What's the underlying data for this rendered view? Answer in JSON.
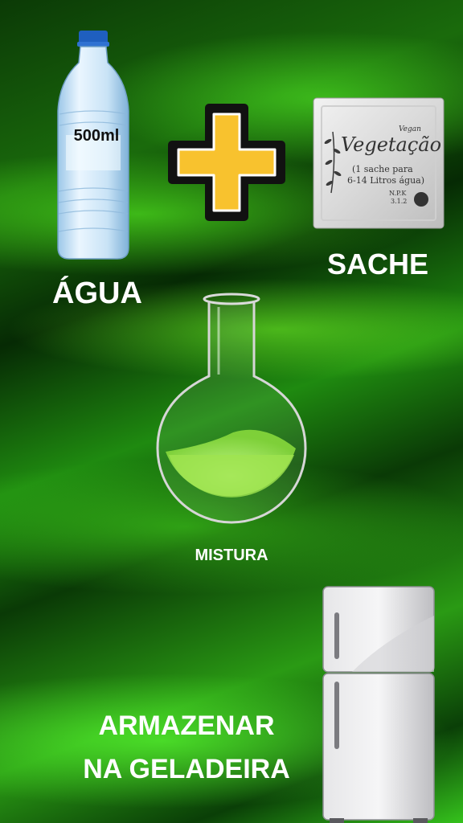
{
  "bottle": {
    "volume_label": "500ml"
  },
  "sachet": {
    "tagline": "Vegan",
    "brand": "Vegetação",
    "instruction_line1": "(1 sache para",
    "instruction_line2": "6-14 Litros água)",
    "npk_label": "N.P.K",
    "npk_value": "3.1.2"
  },
  "labels": {
    "agua": "ÁGUA",
    "sache": "SACHE",
    "mistura": "MISTURA",
    "armazenar_line1": "ARMAZENAR",
    "armazenar_line2": "NA GELADEIRA"
  },
  "colors": {
    "plus_fill": "#f8c22e",
    "plus_stroke": "#111111",
    "liquid": "#a8f25a",
    "accent_green": "#2fbf17"
  },
  "icons": [
    "water-bottle-icon",
    "plus-icon",
    "sachet-icon",
    "flask-icon",
    "refrigerator-icon"
  ]
}
